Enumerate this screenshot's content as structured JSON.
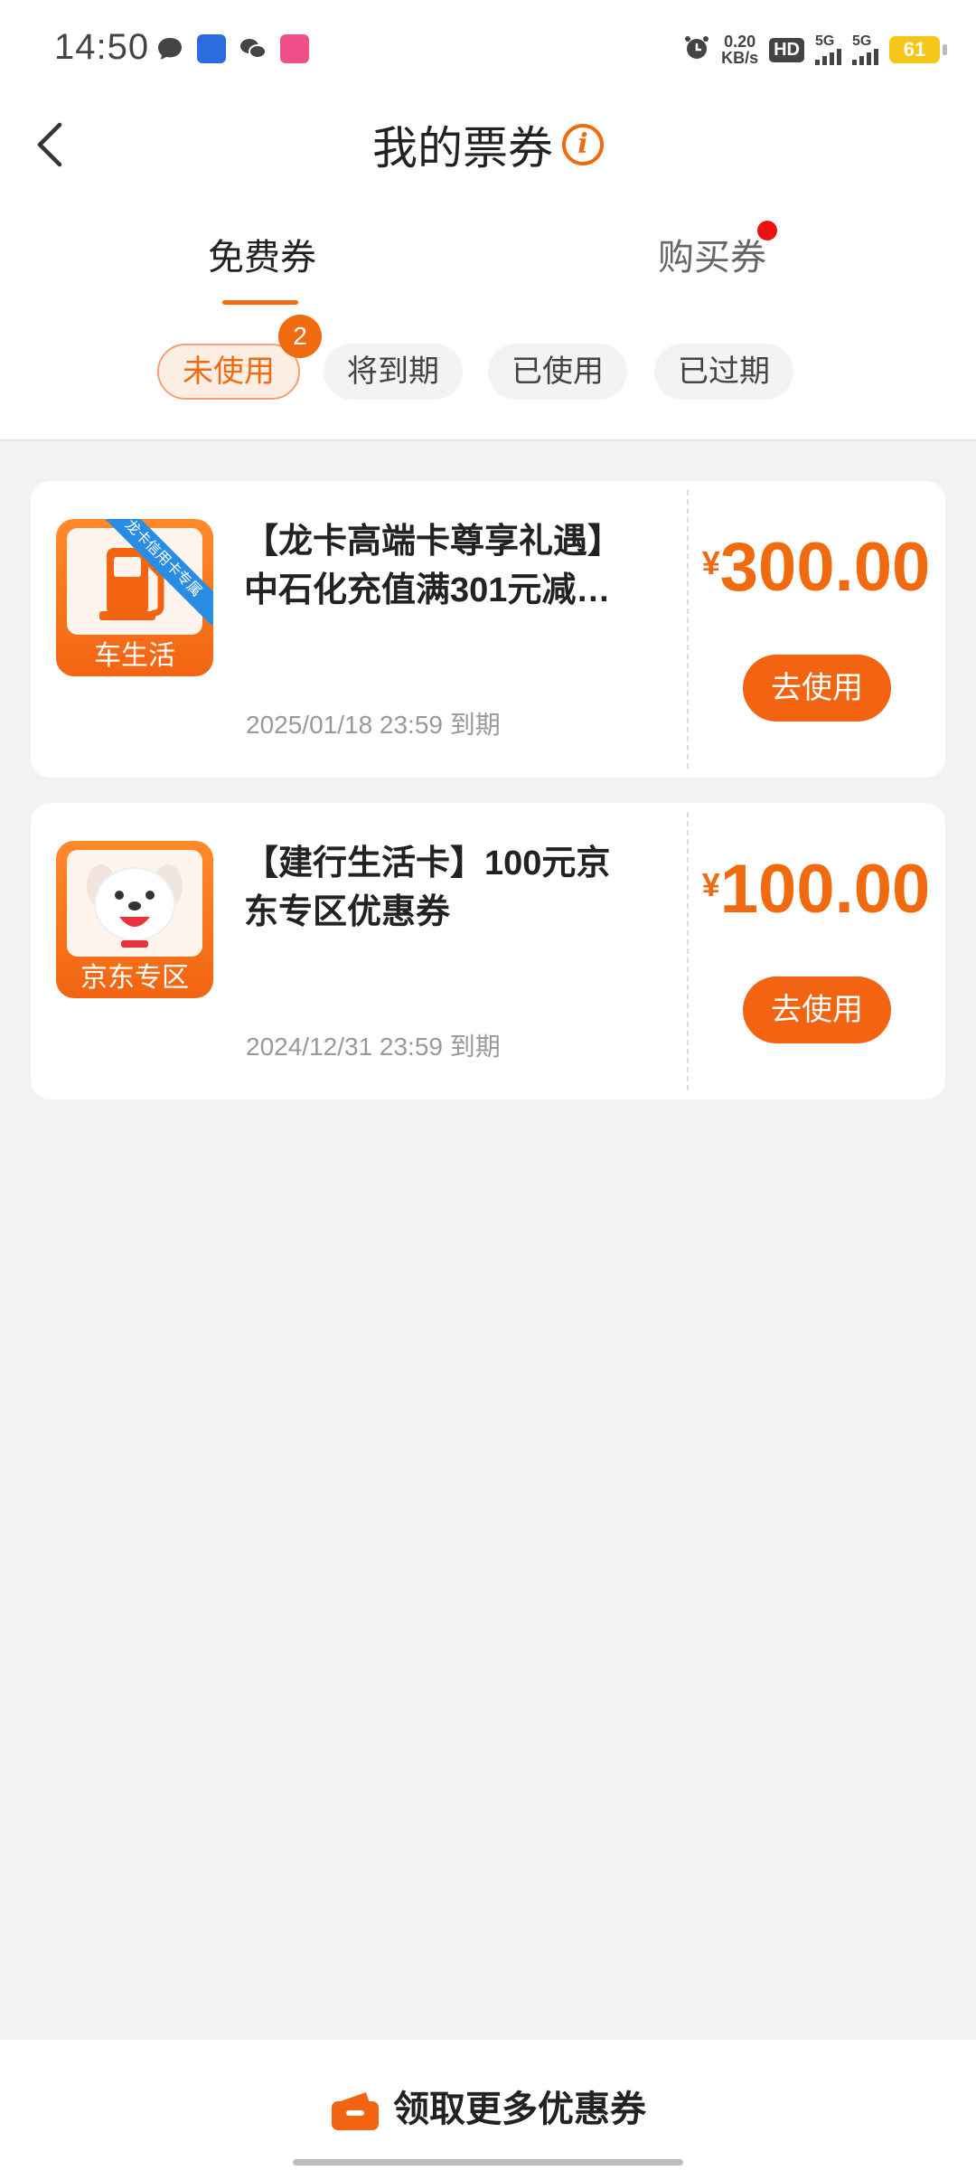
{
  "status_bar": {
    "time": "14:50",
    "speed_value": "0.20",
    "speed_unit": "KB/s",
    "hd": "HD",
    "network1": "5G",
    "network2": "5G",
    "battery": "61"
  },
  "header": {
    "title": "我的票券",
    "info_glyph": "i"
  },
  "tabs": [
    {
      "label": "免费券",
      "active": true
    },
    {
      "label": "购买券",
      "active": false,
      "has_red_dot": true
    }
  ],
  "filters": [
    {
      "label": "未使用",
      "active": true,
      "badge": "2"
    },
    {
      "label": "将到期"
    },
    {
      "label": "已使用"
    },
    {
      "label": "已过期"
    }
  ],
  "coupons": [
    {
      "logo_caption": "车生活",
      "ribbon": "龙卡信用卡专属",
      "title": "【龙卡高端卡尊享礼遇】中石化充值满301元减…",
      "expiry": "2025/01/18 23:59 到期",
      "currency": "¥",
      "amount": "300.00",
      "button": "去使用",
      "logo_icon": "fuel-pump-icon"
    },
    {
      "logo_caption": "京东专区",
      "title": "【建行生活卡】100元京东专区优惠券",
      "expiry": "2024/12/31 23:59 到期",
      "currency": "¥",
      "amount": "100.00",
      "button": "去使用",
      "logo_icon": "jd-dog-icon"
    }
  ],
  "footer": {
    "label": "领取更多优惠券"
  },
  "colors": {
    "accent": "#f06a0f",
    "badge_red": "#ee1111",
    "background": "#f2f2f2"
  }
}
